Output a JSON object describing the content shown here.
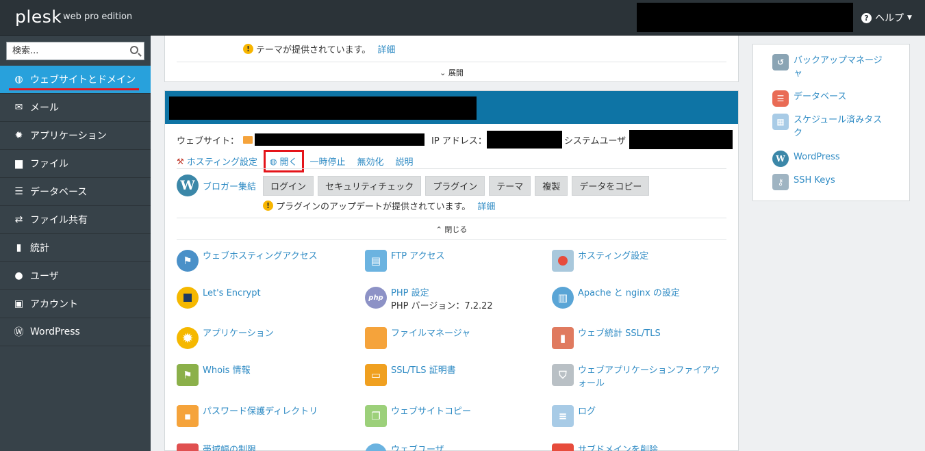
{
  "header": {
    "logo": "plesk",
    "edition": "web pro edition",
    "help_label": "ヘルプ"
  },
  "sidebar": {
    "search_placeholder": "検索...",
    "items": [
      {
        "label": "ウェブサイトとドメイン",
        "icon": "globe-icon",
        "active": true
      },
      {
        "label": "メール",
        "icon": "mail-icon"
      },
      {
        "label": "アプリケーション",
        "icon": "gear-icon"
      },
      {
        "label": "ファイル",
        "icon": "folder-icon"
      },
      {
        "label": "データベース",
        "icon": "database-icon"
      },
      {
        "label": "ファイル共有",
        "icon": "file-share-icon"
      },
      {
        "label": "統計",
        "icon": "bar-chart-icon"
      },
      {
        "label": "ユーザ",
        "icon": "user-icon"
      },
      {
        "label": "アカウント",
        "icon": "account-icon"
      },
      {
        "label": "WordPress",
        "icon": "wordpress-icon"
      }
    ]
  },
  "top_panel": {
    "notice": "テーマが提供されています。",
    "notice_link": "詳細",
    "expand_label": "展開"
  },
  "site": {
    "website_label": "ウェブサイト：",
    "ip_label": "IP アドレス：",
    "sysuser_label": "システムユーザ",
    "actions": {
      "hosting": "ホスティング設定",
      "open": "開く",
      "suspend": "一時停止",
      "disable": "無効化",
      "desc": "説明"
    },
    "wp": {
      "label": "ブロガー集結",
      "buttons": [
        "ログイン",
        "セキュリティチェック",
        "プラグイン",
        "テーマ",
        "複製",
        "データをコピー"
      ],
      "notice": "プラグインのアップデートが提供されています。",
      "notice_link": "詳細",
      "collapse_label": "閉じる"
    },
    "tools": {
      "web_hosting_access": "ウェブホスティングアクセス",
      "ftp_access": "FTP アクセス",
      "hosting_settings": "ホスティング設定",
      "lets_encrypt": "Let's Encrypt",
      "php_settings": "PHP 設定",
      "php_version": "PHP バージョン：7.2.22",
      "apache_nginx": "Apache と nginx の設定",
      "applications": "アプリケーション",
      "file_manager": "ファイルマネージャ",
      "web_stats": "ウェブ統計 SSL/TLS",
      "whois": "Whois 情報",
      "ssl_cert": "SSL/TLS 証明書",
      "waf_line1": "ウェブアプリケーションファイアウ",
      "waf_line2": "ォール",
      "password_dirs": "パスワード保護ディレクトリ",
      "website_copy": "ウェブサイトコピー",
      "logs": "ログ",
      "bandwidth": "帯域幅の制限",
      "web_users": "ウェブユーザ",
      "remove_subdomain": "サブドメインを削除"
    }
  },
  "right_panel": {
    "items": [
      {
        "label_line1": "バックアップマネージ",
        "label_line2": "ャ",
        "icon": "backup-icon"
      },
      {
        "label_line1": "データベース",
        "label_line2": "",
        "icon": "database-icon"
      },
      {
        "label_line1": "スケジュール済みタス",
        "label_line2": "ク",
        "icon": "calendar-icon"
      },
      {
        "label_line1": "WordPress",
        "label_line2": "",
        "icon": "wordpress-icon"
      },
      {
        "label_line1": "SSH Keys",
        "label_line2": "",
        "icon": "ssh-key-icon"
      }
    ]
  }
}
